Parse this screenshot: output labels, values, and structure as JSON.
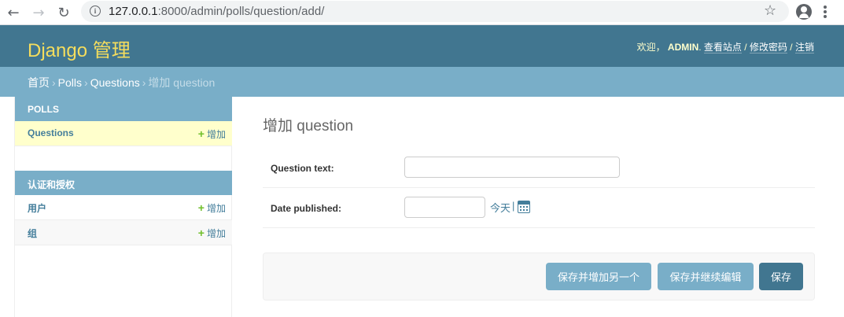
{
  "browser": {
    "url_host": "127.0.0.1",
    "url_rest": ":8000/admin/polls/question/add/"
  },
  "header": {
    "branding": "Django 管理",
    "welcome": "欢迎，",
    "username": "ADMIN",
    "view_site": "查看站点",
    "change_password": "修改密码",
    "logout": "注销",
    "separator": " / "
  },
  "breadcrumbs": {
    "home": "首页",
    "app": "Polls",
    "model": "Questions",
    "current": "增加 question",
    "arrow": "›"
  },
  "sidebar": {
    "modules": [
      {
        "caption": "POLLS",
        "rows": [
          {
            "label": "Questions",
            "add": "增加"
          }
        ]
      },
      {
        "caption": "认证和授权",
        "rows": [
          {
            "label": "用户",
            "add": "增加"
          },
          {
            "label": "组",
            "add": "增加"
          }
        ]
      }
    ]
  },
  "content": {
    "title": "增加 question",
    "fields": {
      "question_text": {
        "label": "Question text:",
        "value": ""
      },
      "date_published": {
        "label": "Date published:",
        "value": "",
        "today": "今天",
        "pipe": "|"
      }
    }
  },
  "submit": {
    "save_add_another": "保存并增加另一个",
    "save_continue": "保存并继续编辑",
    "save": "保存"
  },
  "colors": {
    "header_bg": "#417690",
    "branding": "#f5dd5d",
    "breadcrumb_bg": "#79aec8",
    "link": "#447e9b",
    "current_row": "#ffffcc",
    "add_plus": "#70bf2b"
  },
  "icons": [
    "back-arrow-icon",
    "forward-arrow-icon",
    "reload-icon",
    "info-icon",
    "star-icon",
    "account-icon",
    "menu-icon",
    "plus-icon",
    "calendar-icon"
  ]
}
